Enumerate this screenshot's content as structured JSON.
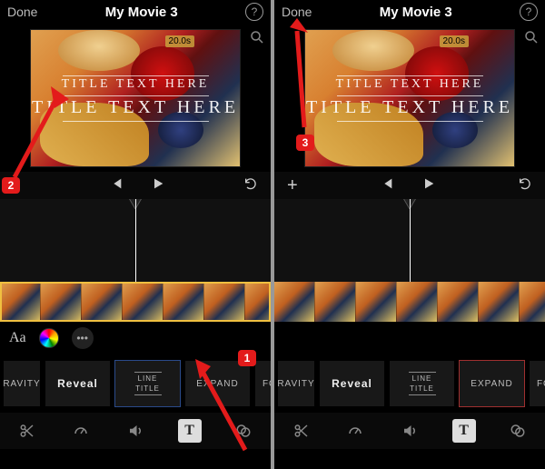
{
  "left": {
    "topbar": {
      "done": "Done",
      "title": "My Movie 3"
    },
    "preview": {
      "duration": "20.0s",
      "title_small": "TITLE TEXT HERE",
      "title_large": "TITLE TEXT HERE"
    },
    "tools": {
      "aa": "Aa",
      "dots": "•••"
    },
    "styles": {
      "s0": "RAVITY",
      "s1": "Reveal",
      "s2a": "LINE",
      "s2b": "TITLE",
      "s3": "EXPAND",
      "s4": "FOC"
    },
    "bottombar": {
      "text_label": "T"
    }
  },
  "right": {
    "topbar": {
      "done": "Done",
      "title": "My Movie 3"
    },
    "preview": {
      "duration": "20.0s",
      "title_small": "TITLE TEXT HERE",
      "title_large": "TITLE TEXT HERE"
    },
    "playbar": {
      "plus": "+"
    },
    "tools": {
      "dots": "•••"
    },
    "styles": {
      "s0": "RAVITY",
      "s1": "Reveal",
      "s2a": "LINE",
      "s2b": "TITLE",
      "s3": "EXPAND",
      "s4": "FOC"
    },
    "bottombar": {
      "text_label": "T"
    }
  },
  "annotations": {
    "b1": "1",
    "b2": "2",
    "b3": "3"
  }
}
